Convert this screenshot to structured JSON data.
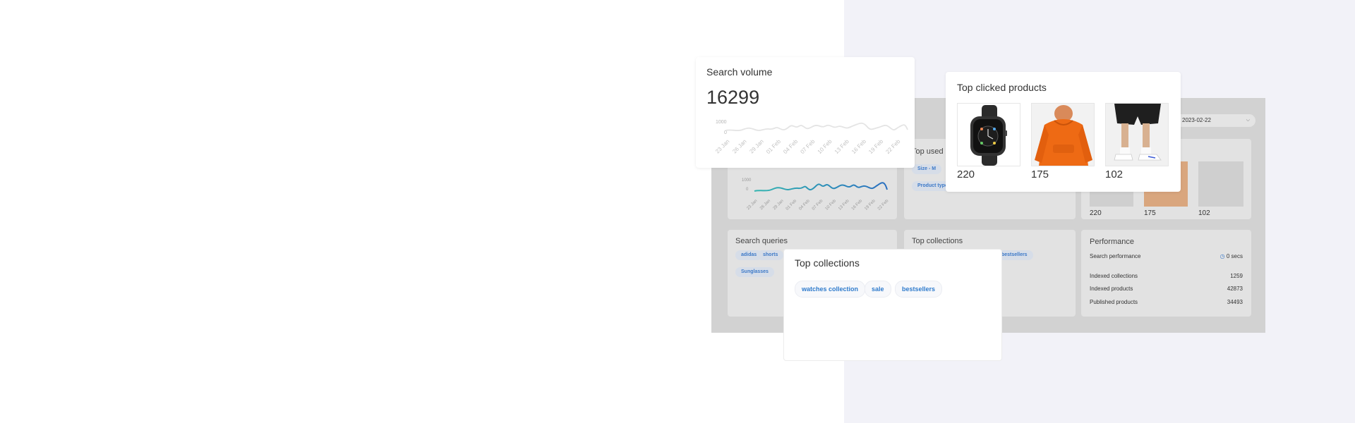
{
  "search_volume": {
    "title": "Search volume",
    "value": "16299",
    "y_ticks": [
      "1000",
      "0"
    ],
    "x_ticks": [
      "23 Jan",
      "26 Jan",
      "29 Jan",
      "01 Feb",
      "04 Feb",
      "07 Feb",
      "10 Feb",
      "13 Feb",
      "16 Feb",
      "19 Feb",
      "22 Feb"
    ]
  },
  "top_clicked_products": {
    "title": "Top clicked products",
    "products": [
      {
        "name": "watch",
        "count": "220"
      },
      {
        "name": "orange-hoodie",
        "count": "175"
      },
      {
        "name": "shorts-sneakers",
        "count": "102"
      }
    ]
  },
  "top_collections": {
    "title": "Top collections",
    "items": [
      "watches collection",
      "sale",
      "bestsellers"
    ]
  },
  "background_dashboard": {
    "date_value": "2023-02-22",
    "volume_partial": "16299",
    "y_ticks": [
      "1000",
      "0"
    ],
    "x_ticks": [
      "23 Jan",
      "26 Jan",
      "29 Jan",
      "01 Feb",
      "04 Feb",
      "07 Feb",
      "10 Feb",
      "13 Feb",
      "16 Feb",
      "19 Feb",
      "22 Feb"
    ],
    "top_used_title": "Top used",
    "top_used_chips": [
      "Size - M",
      "Product type"
    ],
    "search_queries": {
      "title": "Search queries",
      "chips": [
        "adidas",
        "shorts",
        "Sunglasses"
      ]
    },
    "collections": {
      "title": "Top collections",
      "chip_partial": "bestsellers"
    },
    "products": [
      "220",
      "175",
      "102"
    ],
    "performance": {
      "title": "Performance",
      "rows": [
        {
          "label": "Search performance",
          "value": "0 secs"
        },
        {
          "label": "Indexed collections",
          "value": "1259"
        },
        {
          "label": "Indexed products",
          "value": "42873"
        },
        {
          "label": "Published products",
          "value": "34493"
        }
      ]
    }
  },
  "colors": {
    "accent": "#2f7bcc",
    "line_teal": "#33b5b0",
    "line_blue": "#2a6fc0"
  }
}
